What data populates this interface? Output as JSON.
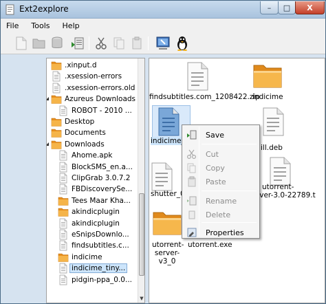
{
  "window": {
    "title": "Ext2explore"
  },
  "titlebar_buttons": {
    "minimize": "–",
    "maximize": "□",
    "close": "X"
  },
  "menu": [
    "File",
    "Tools",
    "Help"
  ],
  "toolbar_icons": [
    "new-file-icon",
    "open-folder-icon",
    "disk-icon",
    "save-icon",
    "cut-icon",
    "copy-icon",
    "paste-icon",
    "rescan-icon",
    "linux-penguin-icon"
  ],
  "tree": [
    {
      "label": ".xinput.d",
      "type": "folder"
    },
    {
      "label": ".xsession-errors",
      "type": "file"
    },
    {
      "label": ".xsession-errors.old",
      "type": "file"
    },
    {
      "label": "Azureus Downloads",
      "type": "folder",
      "expander": "expanded"
    },
    {
      "label": "ROBOT - 2010 ...",
      "type": "file"
    },
    {
      "label": "Desktop",
      "type": "folder"
    },
    {
      "label": "Documents",
      "type": "folder"
    },
    {
      "label": "Downloads",
      "type": "folder",
      "expander": "expanded"
    },
    {
      "label": "Ahome.apk",
      "type": "file"
    },
    {
      "label": "BlockSMS_en.a...",
      "type": "file"
    },
    {
      "label": "ClipGrab 3.0.7.2",
      "type": "file"
    },
    {
      "label": "FBDiscoverySe...",
      "type": "file"
    },
    {
      "label": "Tees Maar Kha...",
      "type": "folder"
    },
    {
      "label": "akindicplugin",
      "type": "folder"
    },
    {
      "label": "akindicplugin",
      "type": "file"
    },
    {
      "label": "eSnipsDownlo...",
      "type": "file"
    },
    {
      "label": "findsubtitles.c...",
      "type": "file"
    },
    {
      "label": "indicime",
      "type": "folder"
    },
    {
      "label": "indicime_tiny...",
      "type": "file",
      "selected": true
    },
    {
      "label": "pidgin-ppa_0.0...",
      "type": "file"
    }
  ],
  "files": [
    {
      "label": "findsubtitles.com_1208422.zip",
      "type": "file"
    },
    {
      "label": "indicime",
      "type": "folder"
    },
    {
      "label": "indicime_",
      "type": "file",
      "selected": true
    },
    {
      "label": "ill.deb",
      "type": "file"
    },
    {
      "label": "shutter_0",
      "type": "file"
    },
    {
      "label": "utorrent-server-3.0-22789.t",
      "type": "file"
    },
    {
      "label": "utorrent-server-v3_0",
      "type": "folder"
    },
    {
      "label": "utorrent.exe",
      "type": "file"
    }
  ],
  "context_menu": {
    "items": [
      {
        "label": "Save",
        "enabled": true,
        "icon": "save-icon"
      },
      {
        "label": "Cut",
        "enabled": false,
        "icon": "cut-icon"
      },
      {
        "label": "Copy",
        "enabled": false,
        "icon": "copy-icon"
      },
      {
        "label": "Paste",
        "enabled": false,
        "icon": "paste-icon"
      },
      {
        "label": "Rename",
        "enabled": false,
        "icon": "rename-icon"
      },
      {
        "label": "Delete",
        "enabled": false,
        "icon": "delete-icon"
      },
      {
        "label": "Properties",
        "enabled": true,
        "icon": "properties-icon"
      }
    ]
  },
  "colors": {
    "folder": "#f0a030",
    "selection": "#cde5fb",
    "title_bg": "#b8cfe6",
    "close_button": "#c4402a"
  }
}
